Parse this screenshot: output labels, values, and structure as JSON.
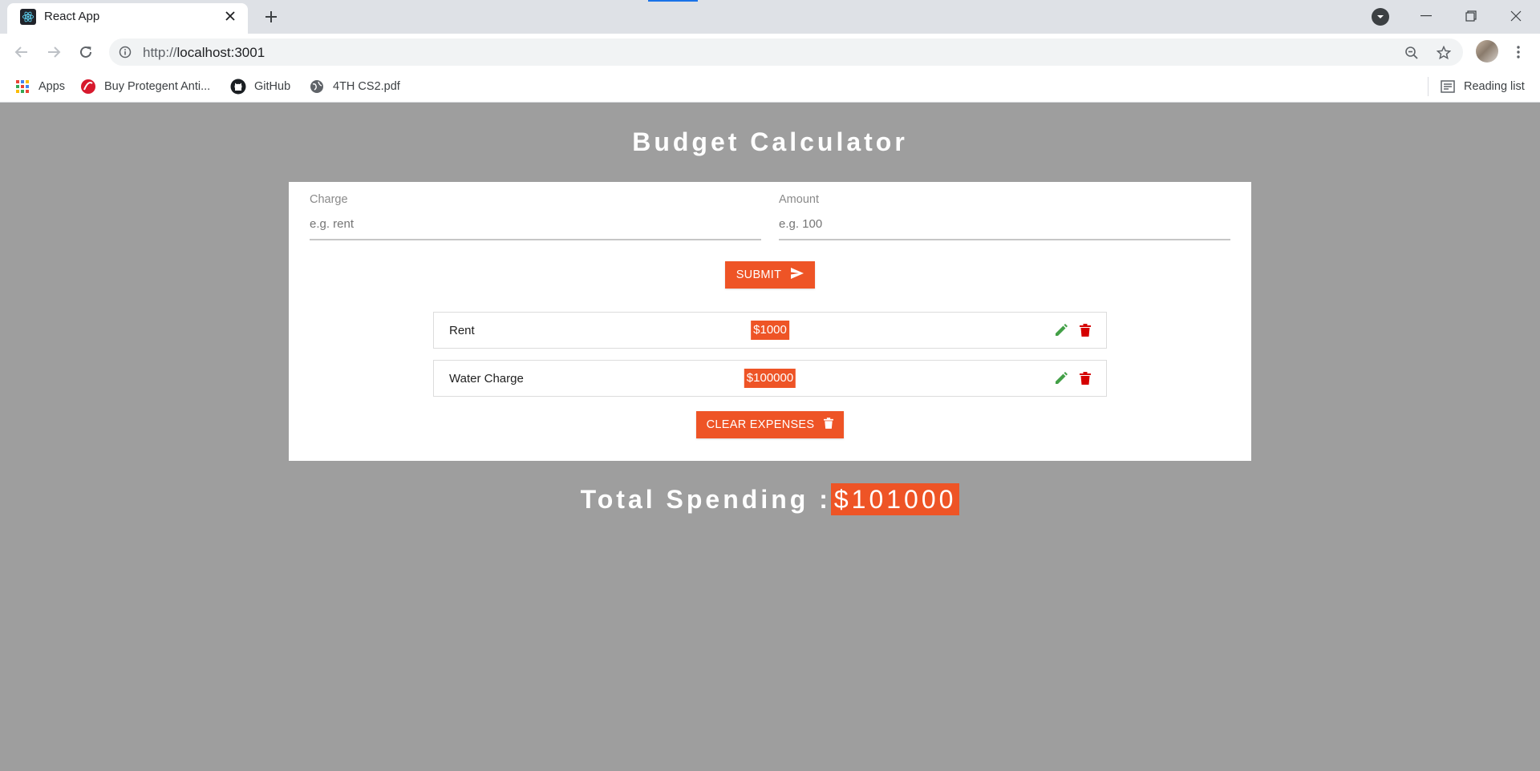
{
  "browser": {
    "tab_title": "React App",
    "url_scheme": "http://",
    "url_host": "localhost:3001",
    "bookmarks": [
      {
        "label": "Apps",
        "icon": "apps-grid-icon"
      },
      {
        "label": "Buy Protegent Anti...",
        "icon": "protegent-icon"
      },
      {
        "label": "GitHub",
        "icon": "github-icon"
      },
      {
        "label": "4TH CS2.pdf",
        "icon": "globe-icon"
      }
    ],
    "reading_list": "Reading list"
  },
  "app": {
    "title": "Budget Calculator",
    "form": {
      "charge_label": "Charge",
      "charge_placeholder": "e.g. rent",
      "amount_label": "Amount",
      "amount_placeholder": "e.g. 100",
      "submit_label": "SUBMIT"
    },
    "expenses": [
      {
        "name": "Rent",
        "amount": "$1000"
      },
      {
        "name": "Water Charge",
        "amount": "$100000"
      }
    ],
    "clear_label": "CLEAR EXPENSES",
    "total_label": "Total Spending :",
    "total_amount": "$101000"
  },
  "colors": {
    "accent": "#ee5426",
    "page_bg": "#9e9e9e",
    "edit_icon": "#43a047",
    "delete_icon": "#d50000"
  }
}
